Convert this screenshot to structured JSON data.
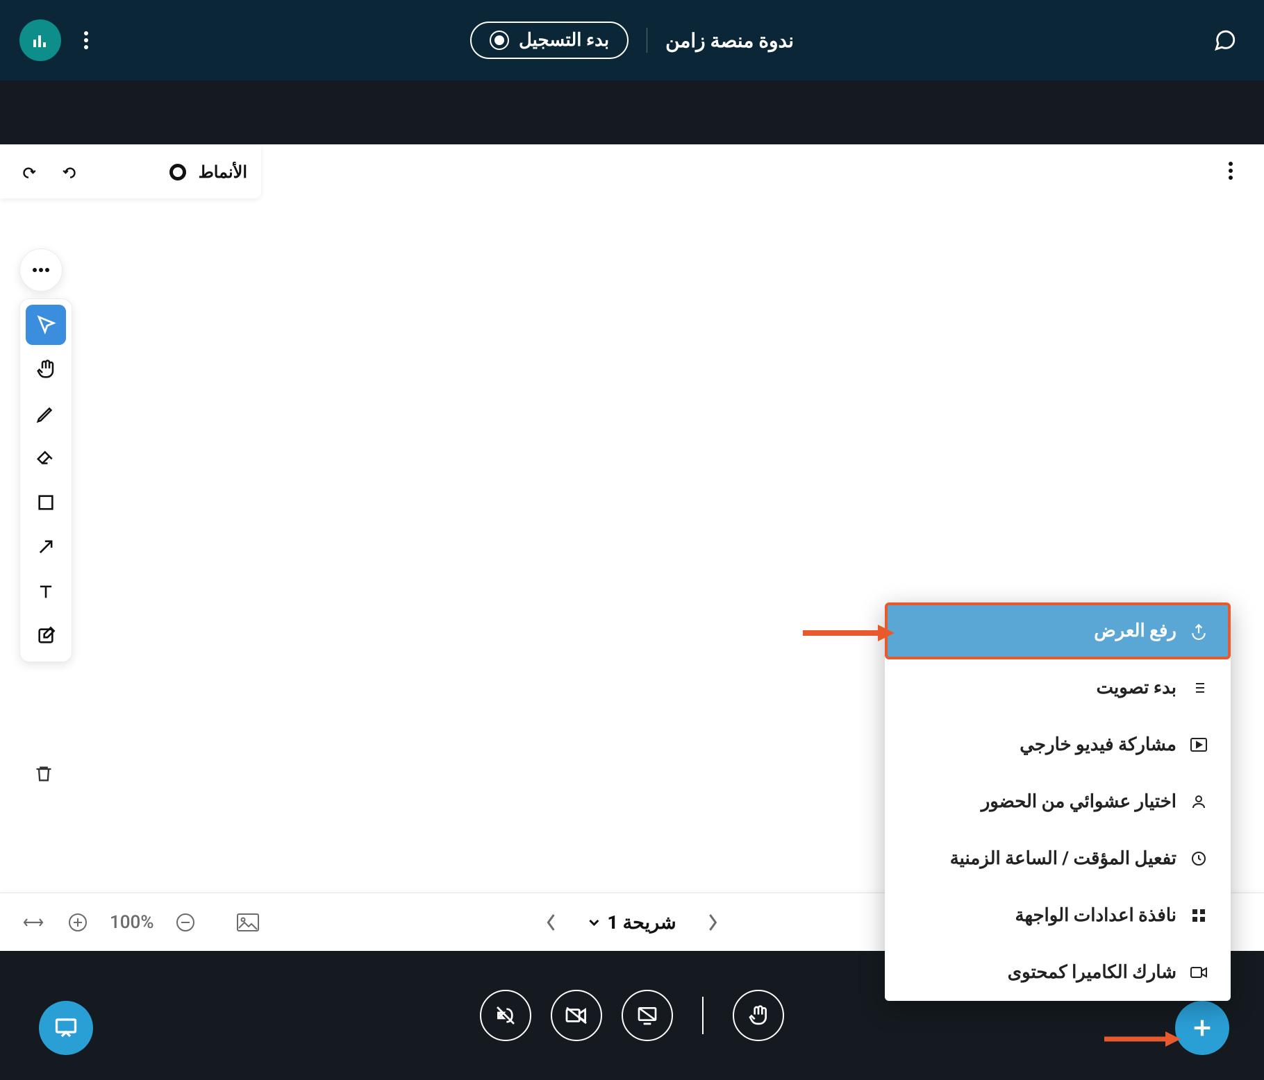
{
  "header": {
    "session_title": "ندوة منصة زامن",
    "start_recording": "بدء التسجيل"
  },
  "wb_top": {
    "styles_label": "الأنماط"
  },
  "slide": {
    "label": "شريحة 1"
  },
  "zoom": {
    "value": "100%"
  },
  "menu": {
    "upload_presentation": "رفع العرض",
    "start_poll": "بدء تصويت",
    "share_external_video": "مشاركة فيديو خارجي",
    "random_attendee": "اختيار عشوائي من الحضور",
    "timer_clock": "تفعيل المؤقت / الساعة الزمنية",
    "layout_settings": "نافذة اعدادات الواجهة",
    "share_camera": "شارك الكاميرا كمحتوى"
  }
}
